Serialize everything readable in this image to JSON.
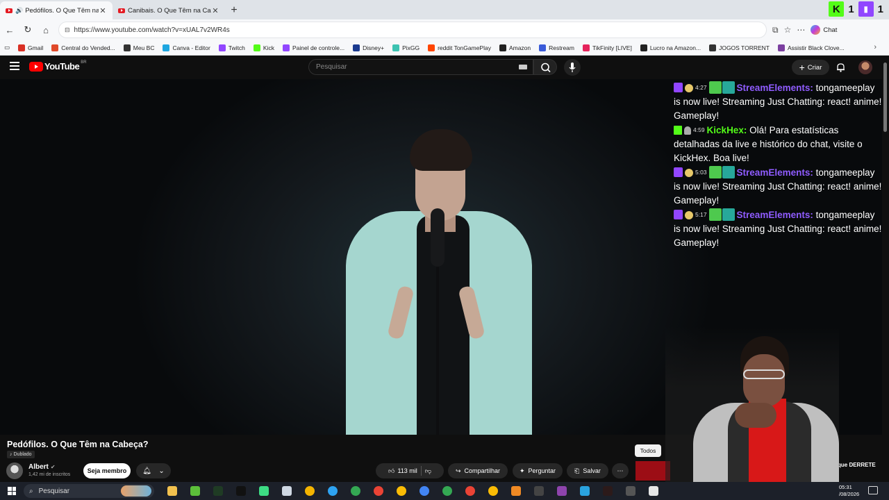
{
  "browser": {
    "tabs": [
      {
        "label": "Pedófilos. O Que Têm na Cabeça?",
        "active": true,
        "playing": true
      },
      {
        "label": "Canibais. O Que Têm na Cabeça?",
        "active": false,
        "playing": false
      }
    ],
    "url": "https://www.youtube.com/watch?v=xUAL7v2WR4s",
    "chat_button": "Chat",
    "extensions": {
      "kick_count": "1",
      "twitch_count": "1"
    },
    "bookmarks": [
      {
        "label": "Gmail",
        "color": "#d93025"
      },
      {
        "label": "Central do Vended...",
        "color": "#e04a2a"
      },
      {
        "label": "Meu BC",
        "color": "#333333"
      },
      {
        "label": "Canva - Editor",
        "color": "#1ea6e0"
      },
      {
        "label": "Twitch",
        "color": "#9146ff"
      },
      {
        "label": "Kick",
        "color": "#53fc18"
      },
      {
        "label": "Painel de controle...",
        "color": "#9146ff"
      },
      {
        "label": "Disney+",
        "color": "#1b3a8f"
      },
      {
        "label": "PixGG",
        "color": "#3dc3b2"
      },
      {
        "label": "reddit TonGamePlay",
        "color": "#ff4500"
      },
      {
        "label": "Amazon",
        "color": "#222222"
      },
      {
        "label": "Restream",
        "color": "#3a5bd9"
      },
      {
        "label": "TikFinity [LIVE]",
        "color": "#e5245c"
      },
      {
        "label": "Lucro na Amazon...",
        "color": "#222222"
      },
      {
        "label": "JOGOS TORRENT",
        "color": "#333333"
      },
      {
        "label": "Assistir Black Clove...",
        "color": "#7b3fa0"
      }
    ]
  },
  "youtube": {
    "logo_text": "YouTube",
    "country": "BR",
    "search_placeholder": "Pesquisar",
    "create_label": "Criar",
    "video_title": "Pedófilos. O Que Têm na Cabeça?",
    "dubbed_label": "Dublado",
    "channel_name": "Albert",
    "channel_subs": "1,42 mi de inscritos",
    "member_label": "Seja membro",
    "likes": "113 mil",
    "share_label": "Compartilhar",
    "ask_label": "Perguntar",
    "save_label": "Salvar",
    "filter_chip": "Todos",
    "clip_text": "que DERRETE"
  },
  "chat_messages": [
    {
      "platform": "twitch",
      "time": "4:27",
      "user": "StreamElements:",
      "text": "tongameeplay is now live! Streaming Just Chatting: react! anime! Gameplay!"
    },
    {
      "platform": "kick",
      "time": "4:59",
      "user": "KickHex:",
      "text": "Olá! Para estatísticas detalhadas da live e histórico do chat, visite o KickHex. Boa live!"
    },
    {
      "platform": "twitch",
      "time": "5:03",
      "user": "StreamElements:",
      "text": "tongameeplay is now live! Streaming Just Chatting: react! anime! Gameplay!"
    },
    {
      "platform": "twitch",
      "time": "5:17",
      "user": "StreamElements:",
      "text": "tongameeplay is now live! Streaming Just Chatting: react! anime! Gameplay!"
    }
  ],
  "taskbar": {
    "search_label": "Pesquisar",
    "time": "05:31",
    "date": "/08/2026",
    "apps": [
      {
        "name": "file-explorer-icon",
        "color": "#f2c14e"
      },
      {
        "name": "green-app-icon",
        "color": "#5cbf3a"
      },
      {
        "name": "terminal-icon",
        "color": "#1f3b24"
      },
      {
        "name": "tiktok-icon",
        "color": "#111111"
      },
      {
        "name": "play-store-icon",
        "color": "#3ddc84"
      },
      {
        "name": "circle-app-icon",
        "color": "#cfd8e3"
      },
      {
        "name": "chrome-icon-1",
        "color": "#f4b400"
      },
      {
        "name": "edge-icon",
        "color": "#2ea3f2"
      },
      {
        "name": "chrome-icon-2",
        "color": "#34a853"
      },
      {
        "name": "chrome-icon-3",
        "color": "#ea4335"
      },
      {
        "name": "chrome-icon-4",
        "color": "#fbbc05"
      },
      {
        "name": "chrome-icon-5",
        "color": "#4285f4"
      },
      {
        "name": "chrome-icon-6",
        "color": "#34a853"
      },
      {
        "name": "chrome-icon-7",
        "color": "#ea4335"
      },
      {
        "name": "chrome-icon-8",
        "color": "#fbbc05"
      },
      {
        "name": "orange-app-icon",
        "color": "#f08a24"
      },
      {
        "name": "obs-icon",
        "color": "#444444"
      },
      {
        "name": "green-purple-app-icon",
        "color": "#8e44ad"
      },
      {
        "name": "telegram-icon",
        "color": "#2aa3df"
      },
      {
        "name": "game-icon",
        "color": "#2c1a1a"
      },
      {
        "name": "pen-app-icon",
        "color": "#555555"
      },
      {
        "name": "mz-app-icon",
        "color": "#e6e6e6"
      }
    ]
  }
}
